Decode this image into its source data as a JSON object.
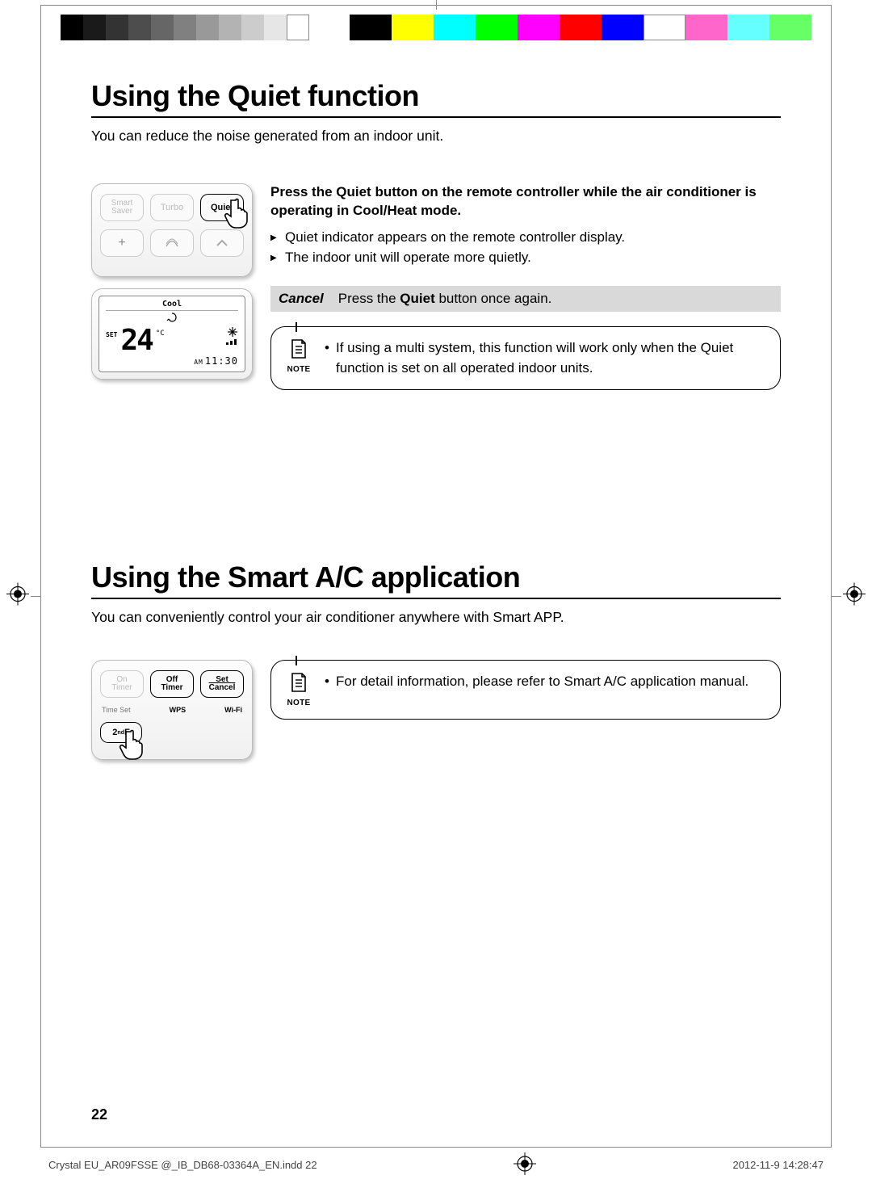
{
  "print": {
    "gray_swatches": [
      "#000000",
      "#1a1a1a",
      "#333333",
      "#4d4d4d",
      "#666666",
      "#808080",
      "#999999",
      "#b3b3b3",
      "#cccccc",
      "#e6e6e6",
      "#ffffff"
    ],
    "color_swatches": [
      "#000000",
      "#ffff00",
      "#00ffff",
      "#00ff00",
      "#ff00ff",
      "#ff0000",
      "#0000ff",
      "#ffffff",
      "#ff66cc",
      "#66ffff",
      "#66ff66"
    ]
  },
  "section1": {
    "heading": "Using the Quiet function",
    "intro": "You can reduce the noise generated from an indoor unit.",
    "step_prefix": "Press the ",
    "step_bold1": "Quiet",
    "step_mid": " button on the remote controller while the air conditioner is operating ",
    "step_bold2": "in Cool/Heat mode.",
    "bullets": [
      "Quiet indicator appears on the remote controller display.",
      "The indoor unit will operate more quietly."
    ],
    "cancel": {
      "label": "Cancel",
      "text_pre": "Press the ",
      "text_bold": "Quiet",
      "text_post": " button once again."
    },
    "note_label": "NOTE",
    "note_items": [
      "If using a multi system, this function will work only when the Quiet function is set on all operated indoor units."
    ],
    "remote_top": {
      "btn_smartsaver_l1": "Smart",
      "btn_smartsaver_l2": "Saver",
      "btn_turbo": "Turbo",
      "btn_quiet": "Quiet"
    },
    "lcd": {
      "mode": "Cool",
      "set": "SET",
      "temp": "24",
      "deg": "°C",
      "ampm": "AM",
      "time": "11:30"
    }
  },
  "section2": {
    "heading": "Using the Smart A/C application",
    "intro": "You can conveniently control your air conditioner anywhere with Smart APP.",
    "note_label": "NOTE",
    "note_items": [
      "For detail information, please refer to Smart A/C application manual."
    ],
    "remote": {
      "on_l1": "On",
      "on_l2": "Timer",
      "off_l1": "Off",
      "off_l2": "Timer",
      "set_l1": "Set",
      "set_l2": "Cancel",
      "sub_timeset": "Time Set",
      "sub_wps": "WPS",
      "sub_wifi": "Wi-Fi",
      "secondf_pre": "2",
      "secondf_sup": "nd",
      "secondf_post": " F"
    }
  },
  "page_number": "22",
  "footer": {
    "left": "Crystal  EU_AR09FSSE @_IB_DB68-03364A_EN.indd   22",
    "right": "2012-11-9   14:28:47"
  }
}
